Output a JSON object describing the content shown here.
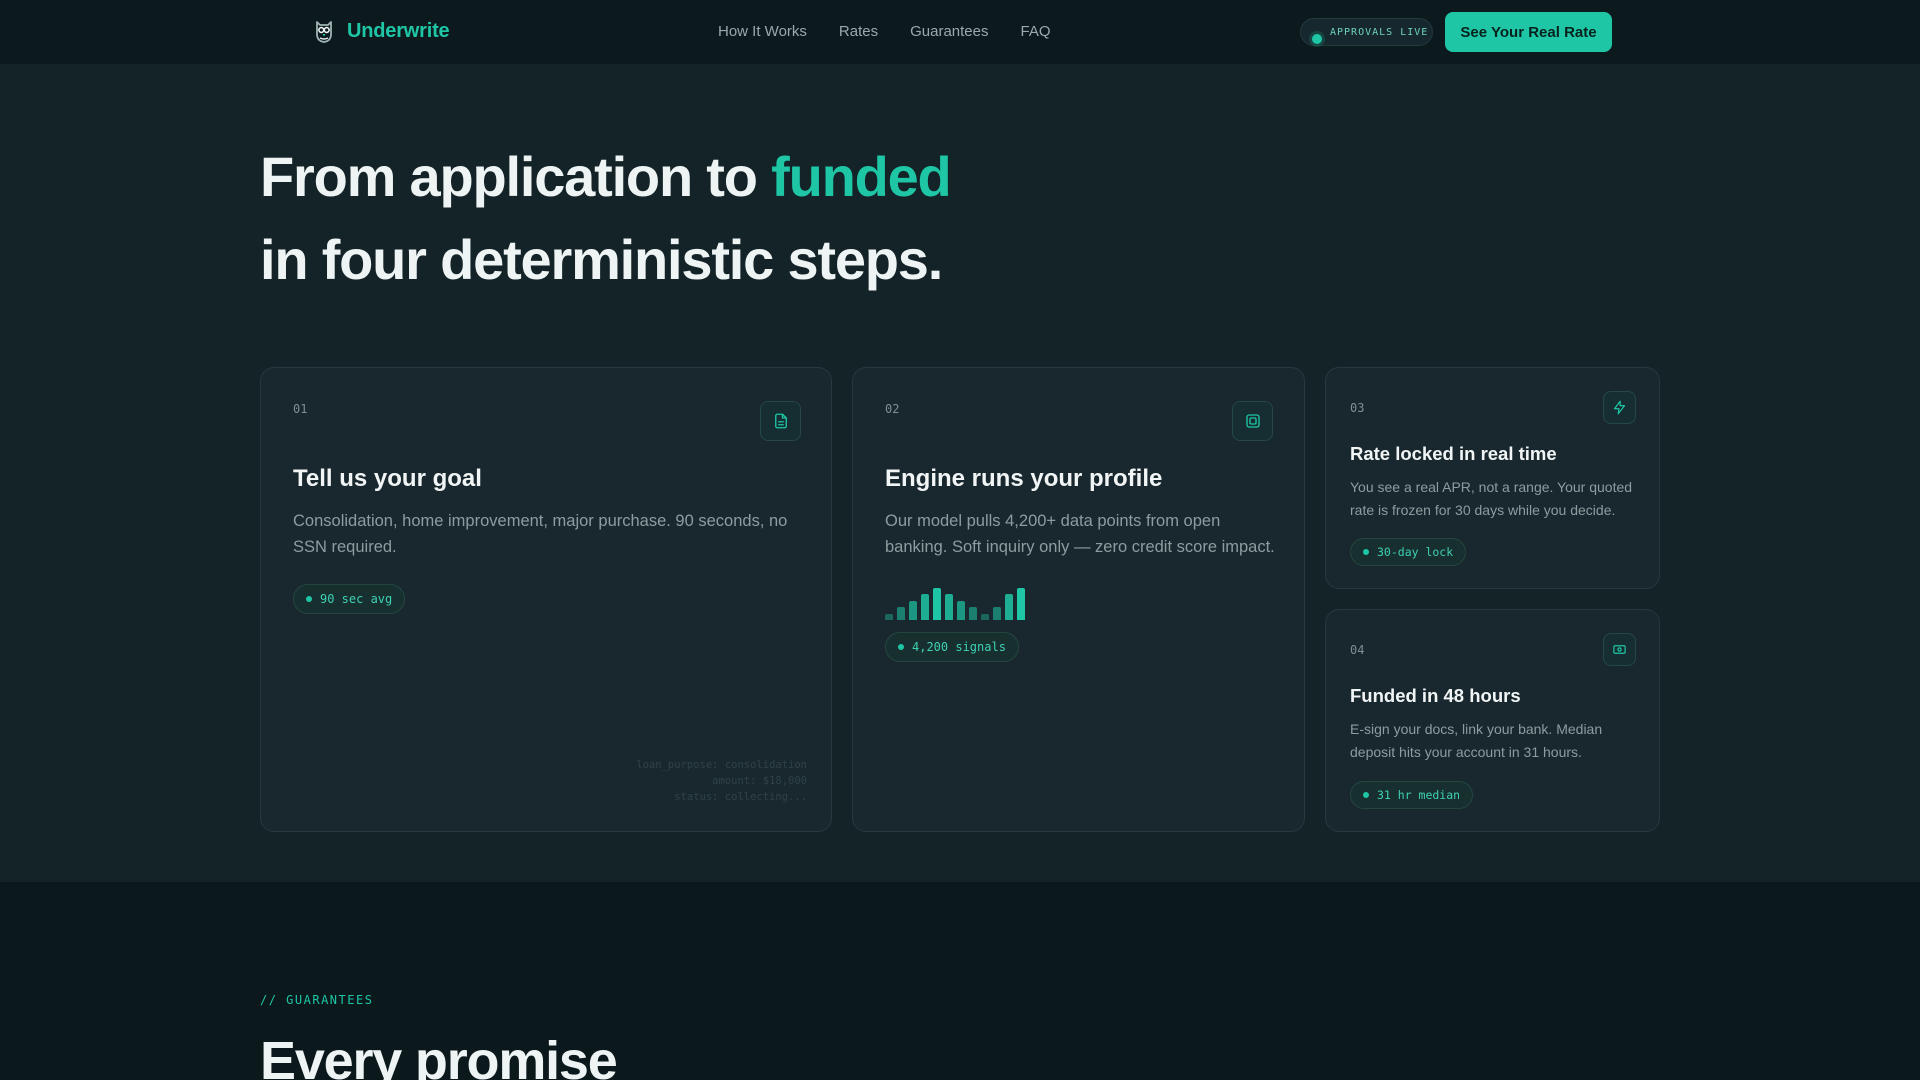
{
  "nav": {
    "brand": "Underwrite",
    "links": [
      "How It Works",
      "Rates",
      "Guarantees",
      "FAQ"
    ],
    "status": "APPROVALS LIVE",
    "cta": "See Your Real Rate"
  },
  "hero": {
    "line1_prefix": "From application to ",
    "line1_accent": "funded",
    "line2": "in four deterministic steps."
  },
  "steps": [
    {
      "num": "01",
      "icon": "document-icon",
      "title": "Tell us your goal",
      "desc": "Consolidation, home improvement, major purchase. 90 seconds, no SSN required.",
      "tag": "90 sec avg",
      "ghost": [
        "loan_purpose: consolidation",
        "amount: $18,000",
        "status: collecting..."
      ]
    },
    {
      "num": "02",
      "icon": "cpu-chip-icon",
      "title": "Engine runs your profile",
      "desc": "Our model pulls 4,200+ data points from open banking. Soft inquiry only — zero credit score impact.",
      "tag": "4,200 signals",
      "signal_bars": [
        0.2,
        0.4,
        0.6,
        0.8,
        1.0,
        0.8,
        0.6,
        0.4,
        0.2,
        0.4,
        0.8,
        1.0
      ]
    },
    {
      "num": "03",
      "icon": "lightning-bolt-icon",
      "title": "Rate locked in real time",
      "desc": "You see a real APR, not a range. Your quoted rate is frozen for 30 days while you decide.",
      "tag": "30-day lock"
    },
    {
      "num": "04",
      "icon": "cash-icon",
      "title": "Funded in 48 hours",
      "desc": "E-sign your docs, link your bank. Median deposit hits your account in 31 hours.",
      "tag": "31 hr median"
    }
  ],
  "guarantees": {
    "eyebrow": "// GUARANTEES",
    "title": "Every promise"
  },
  "colors": {
    "accent": "#1ec6a6",
    "background": "#132328",
    "card": "#19282e"
  }
}
